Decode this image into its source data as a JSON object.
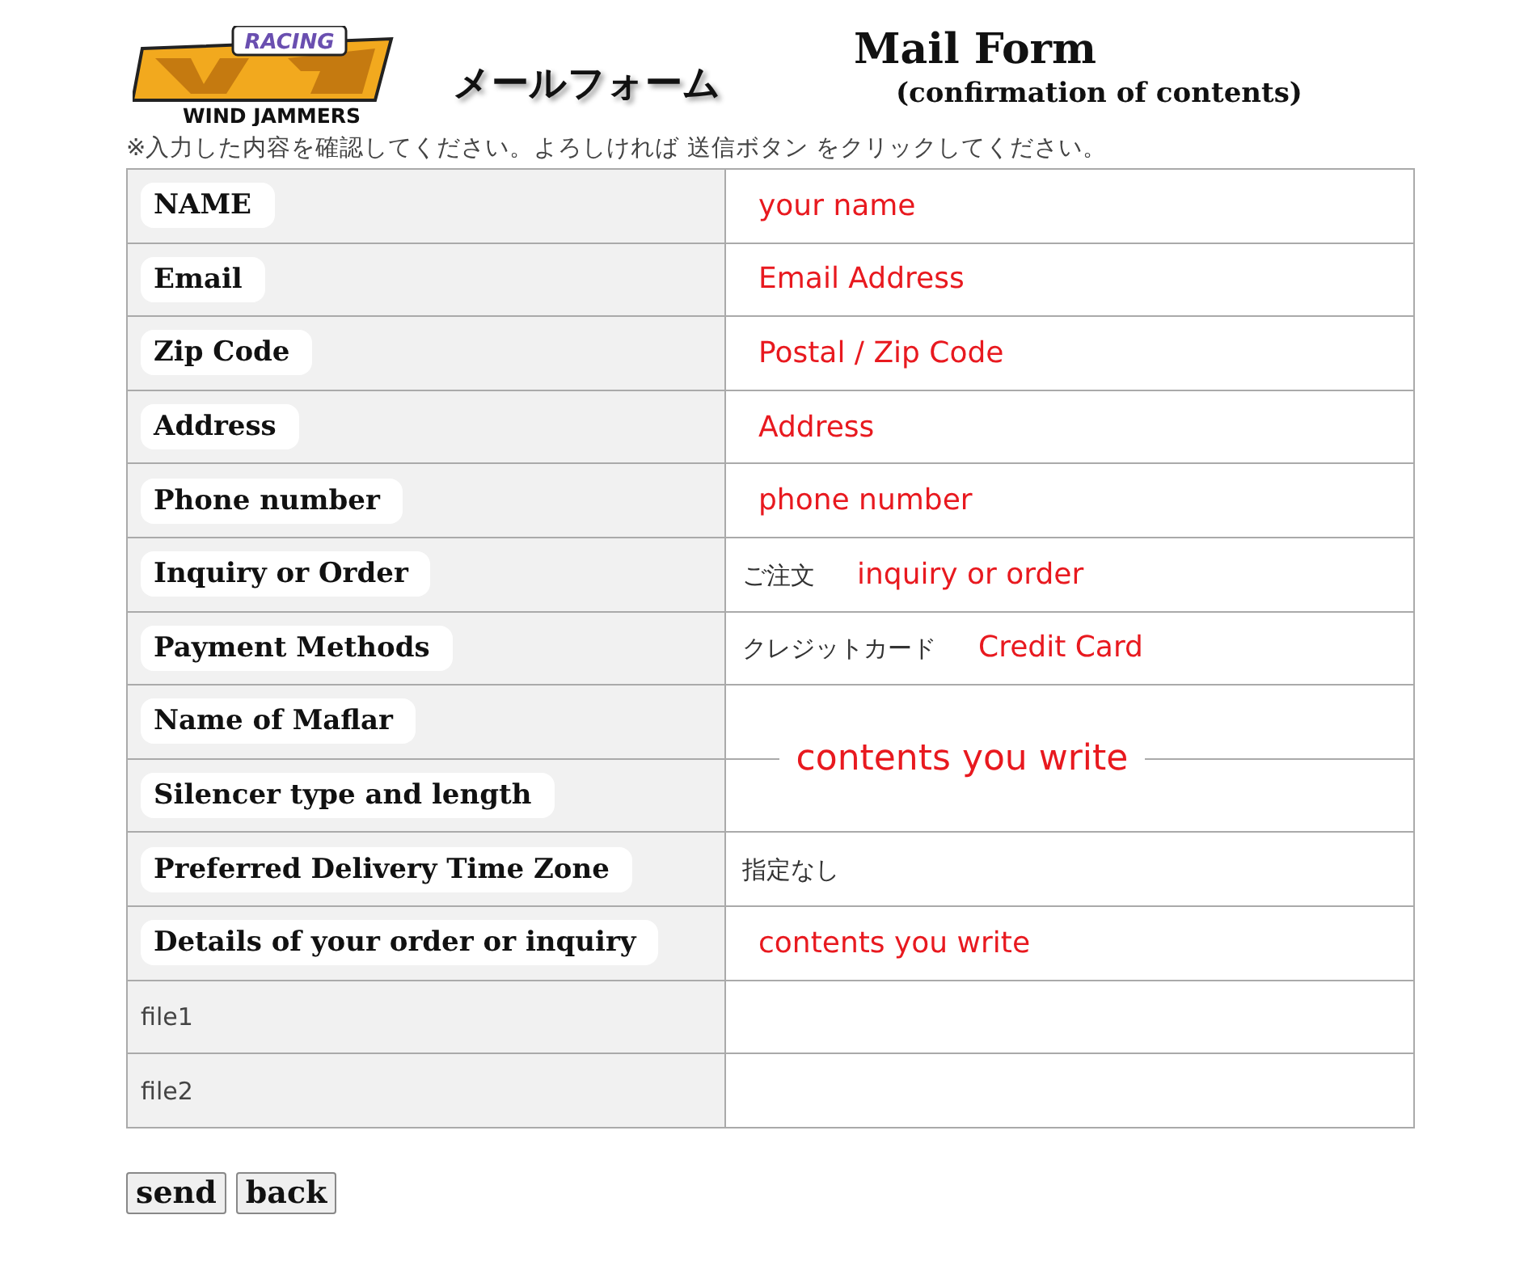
{
  "logo": {
    "top": "RACING",
    "bottom": "WIND JAMMERS"
  },
  "heading": "メールフォーム",
  "title": "Mail Form",
  "subtitle": "(confirmation of contents)",
  "notice": "※入力した内容を確認してください。よろしければ 送信ボタン をクリックしてください。",
  "rows": [
    {
      "kind": "field",
      "label": "NAME",
      "note": "your name"
    },
    {
      "kind": "field",
      "label": "Email",
      "note": "Email Address"
    },
    {
      "kind": "field",
      "label": "Zip Code",
      "note": "Postal / Zip Code"
    },
    {
      "kind": "field",
      "label": "Address",
      "note": "Address"
    },
    {
      "kind": "field",
      "label": "Phone number",
      "note": "phone number"
    },
    {
      "kind": "field",
      "label": "Inquiry or Order",
      "value": "ご注文",
      "note": "inquiry or order"
    },
    {
      "kind": "field",
      "label": "Payment Methods",
      "value": "クレジットカード",
      "note": "Credit Card"
    },
    {
      "kind": "group",
      "labels": [
        "Name of Maflar",
        "Silencer type and length"
      ],
      "note": "contents you write"
    },
    {
      "kind": "field",
      "label": "Preferred Delivery Time Zone",
      "value": "指定なし"
    },
    {
      "kind": "field",
      "label": "Details of your order or inquiry",
      "note": "contents you write"
    },
    {
      "kind": "plain",
      "label": "file1"
    },
    {
      "kind": "plain",
      "label": "file2"
    }
  ],
  "buttons": [
    "send",
    "back"
  ]
}
